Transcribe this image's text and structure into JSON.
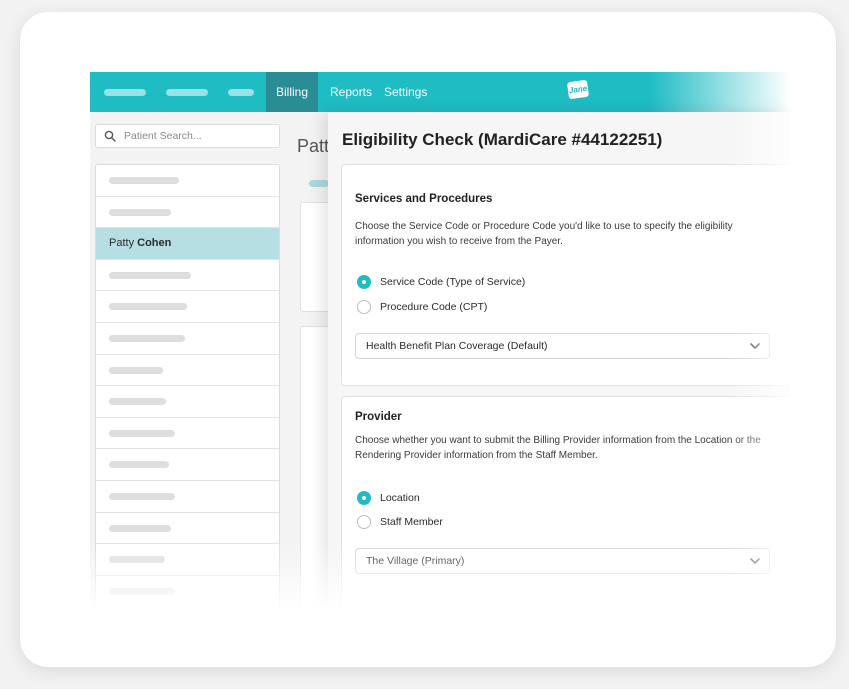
{
  "topnav": {
    "items": [
      "Billing",
      "Reports",
      "Settings"
    ],
    "active": "Billing",
    "logo_text": "Jane"
  },
  "sidebar": {
    "search_placeholder": "Patient Search...",
    "selected_first": "Patty",
    "selected_last": "Cohen"
  },
  "main": {
    "title_partial": "Patt"
  },
  "panel": {
    "title": "Eligibility Check (MardiCare #44122251)",
    "services": {
      "title": "Services and Procedures",
      "description": "Choose the Service Code or Procedure Code you'd like to use to specify the eligibility information you wish to receive from the Payer.",
      "options": [
        "Service Code (Type of Service)",
        "Procedure Code (CPT)"
      ],
      "selected_option": "Service Code (Type of Service)",
      "select_value": "Health Benefit Plan Coverage (Default)"
    },
    "provider": {
      "title": "Provider",
      "description": "Choose whether you want to submit the Billing Provider information from the Location or the Rendering Provider information from the Staff Member.",
      "options": [
        "Location",
        "Staff Member"
      ],
      "selected_option": "Location",
      "select_value": "The Village (Primary)"
    }
  },
  "colors": {
    "accent": "#1fbcc4",
    "nav_active": "#2a8d96",
    "selected_row": "#b6dfe3"
  }
}
